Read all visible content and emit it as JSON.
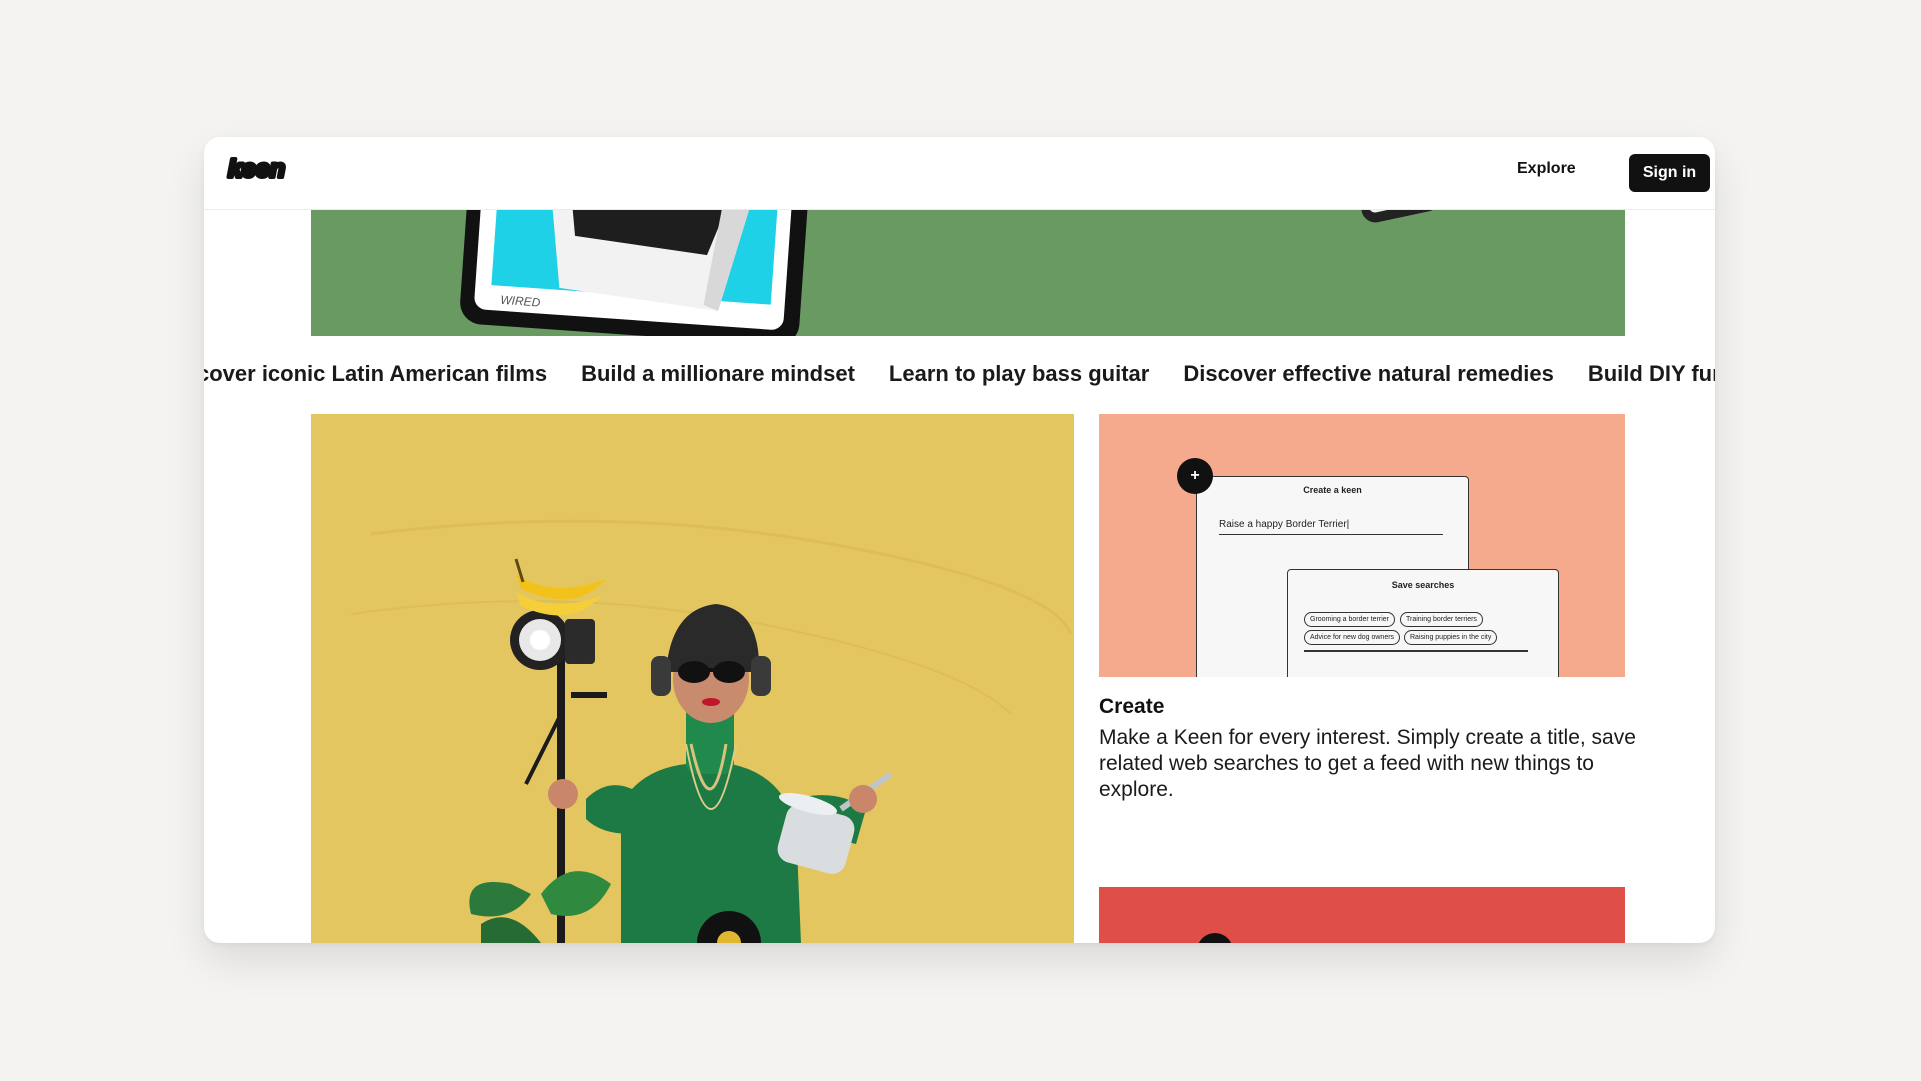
{
  "header": {
    "logo_text": "keen",
    "explore_label": "Explore",
    "signin_label": "Sign in"
  },
  "hero": {
    "magazine_label": "WIRED"
  },
  "ticker": {
    "items": [
      "cover iconic Latin American films",
      "Build a millionare mindset",
      "Learn to play bass guitar",
      "Discover effective natural remedies",
      "Build DIY furnitur"
    ]
  },
  "create_card": {
    "mock_title": "Create a keen",
    "mock_input": "Raise a happy Border Terrier|",
    "mock_searches_title": "Save searches",
    "mock_pills": [
      "Grooming a border terrier",
      "Training border terriers",
      "Advice for new dog owners",
      "Raising puppies in the city"
    ],
    "heading": "Create",
    "description": "Make a Keen for every interest. Simply create a title, save related web searches to get a feed with new things to explore."
  },
  "colors": {
    "green": "#689a62",
    "yellow": "#e4c660",
    "peach": "#f5a98d",
    "red": "#df4e47",
    "dark": "#111111"
  }
}
